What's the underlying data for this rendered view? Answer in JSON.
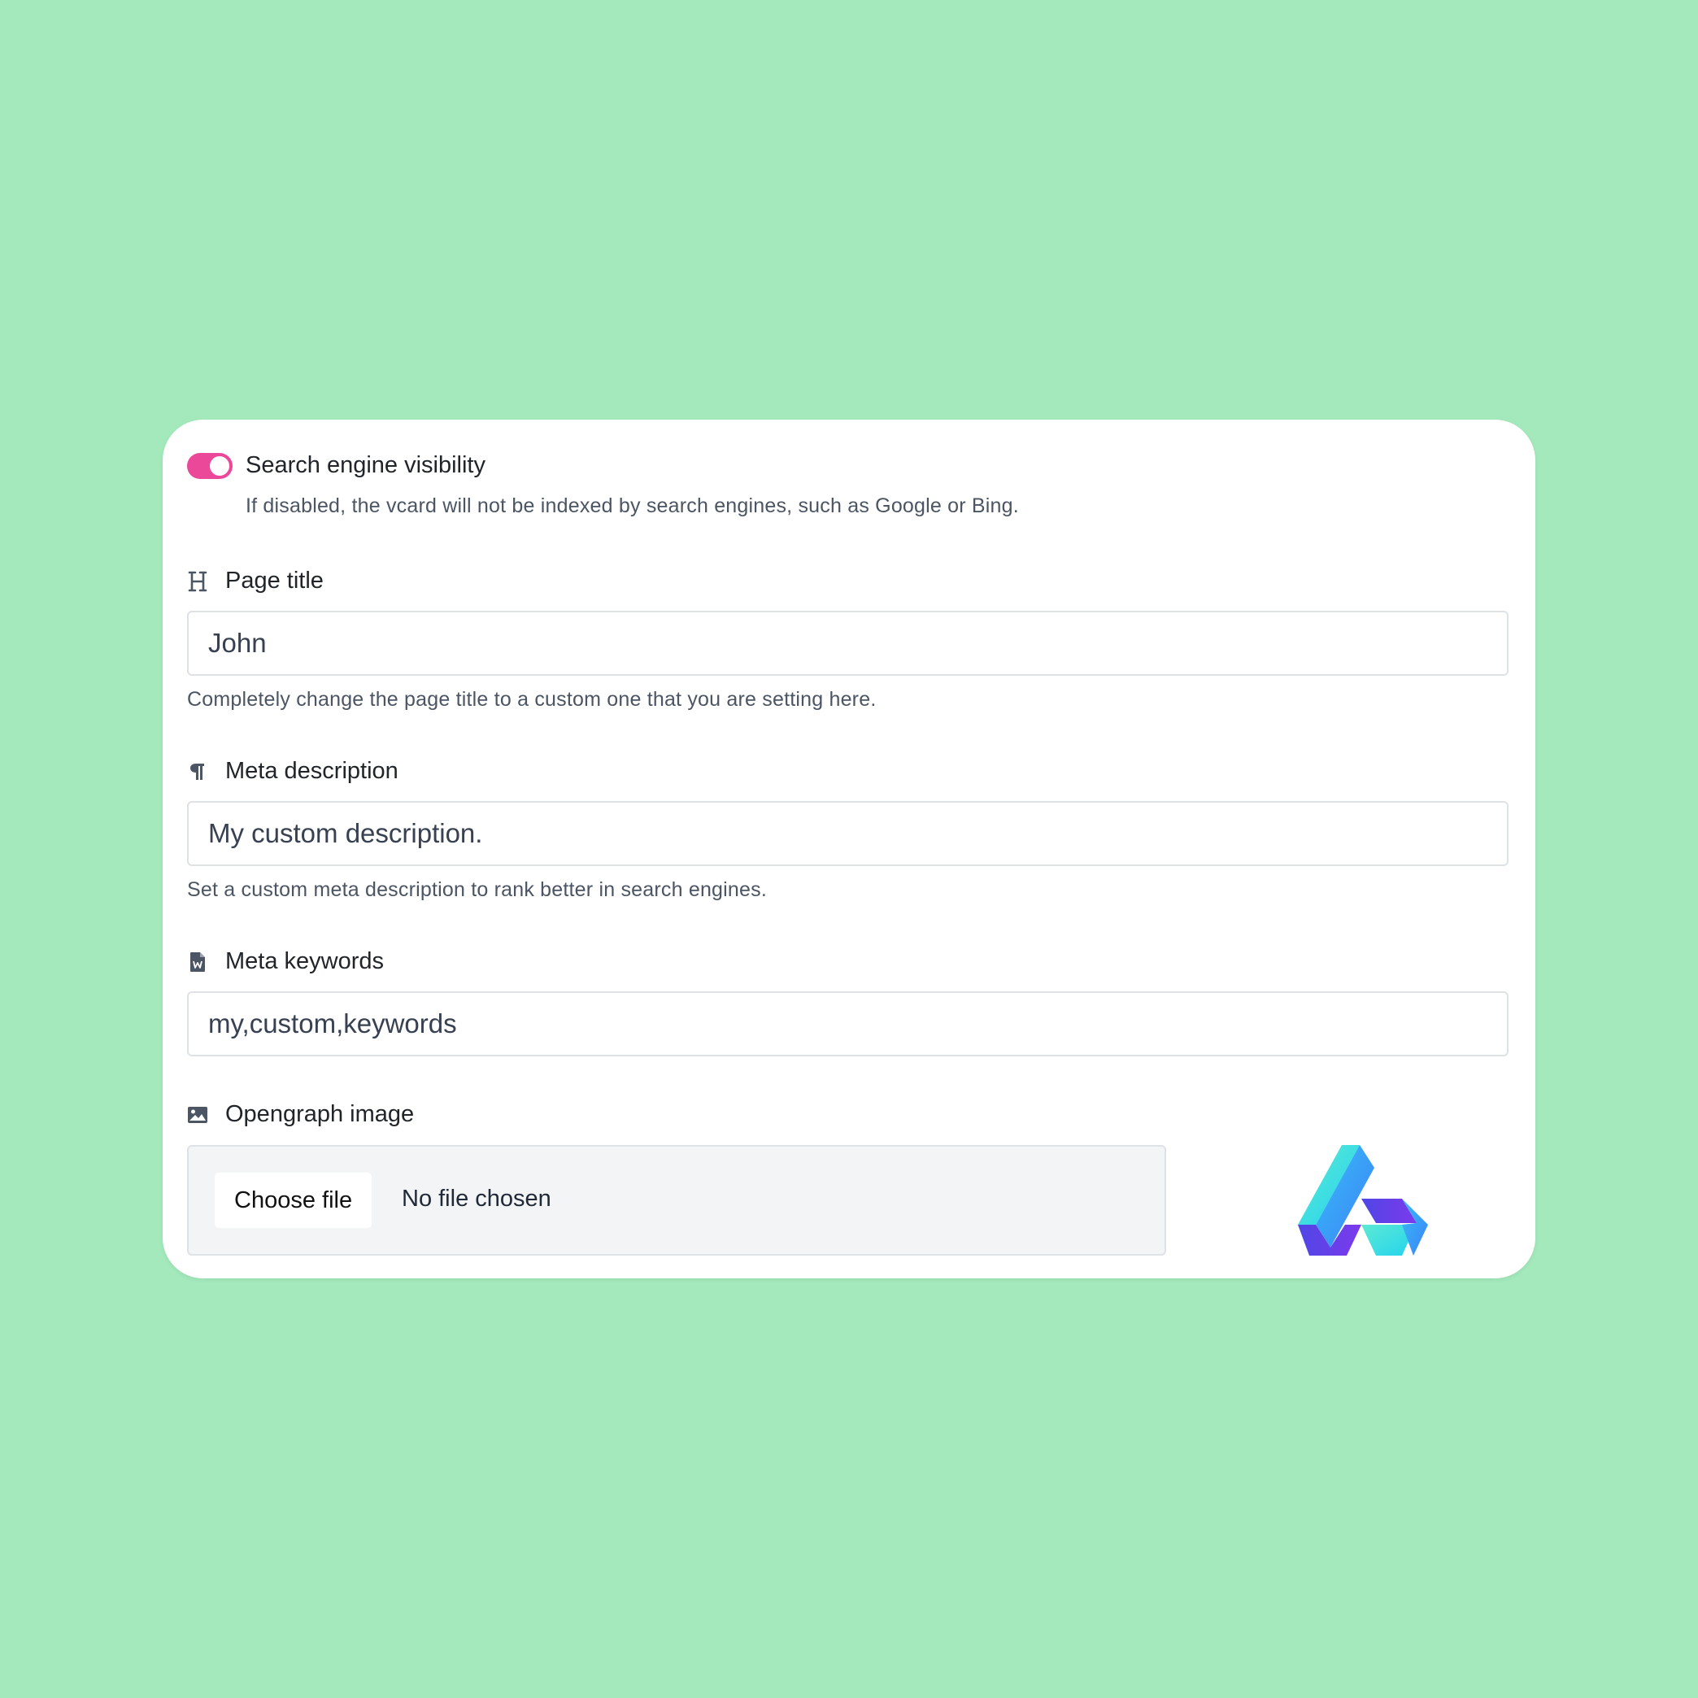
{
  "colors": {
    "background": "#a3e9bc",
    "toggle_on": "#ec4899",
    "card": "#ffffff"
  },
  "visibility": {
    "label": "Search engine visibility",
    "enabled": true,
    "help": "If disabled, the vcard will not be indexed by search engines, such as Google or Bing."
  },
  "page_title": {
    "icon": "heading-icon",
    "label": "Page title",
    "value": "John",
    "help": "Completely change the page title to a custom one that you are setting here."
  },
  "meta_description": {
    "icon": "paragraph-icon",
    "label": "Meta description",
    "value": "My custom description.",
    "help": "Set a custom meta description to rank better in search engines."
  },
  "meta_keywords": {
    "icon": "word-file-icon",
    "label": "Meta keywords",
    "value": "my,custom,keywords"
  },
  "opengraph": {
    "icon": "image-icon",
    "label": "Opengraph image",
    "button_label": "Choose file",
    "status": "No file chosen",
    "preview": "brand-logo"
  }
}
